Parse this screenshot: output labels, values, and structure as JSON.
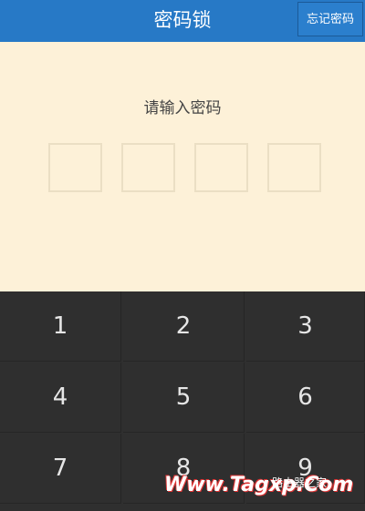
{
  "header": {
    "title": "密码锁",
    "forgot_label": "忘记密码"
  },
  "lock": {
    "prompt": "请输入密码",
    "pin_slots": 4
  },
  "keypad": {
    "keys": [
      "1",
      "2",
      "3",
      "4",
      "5",
      "6",
      "7",
      "8",
      "9"
    ]
  },
  "watermark": {
    "text": "Www.Tagxp.Com",
    "site": "路由器之家"
  },
  "colors": {
    "header_bg": "#2779c6",
    "lock_bg": "#fdf1d8",
    "keypad_bg": "#2f2f2f"
  }
}
